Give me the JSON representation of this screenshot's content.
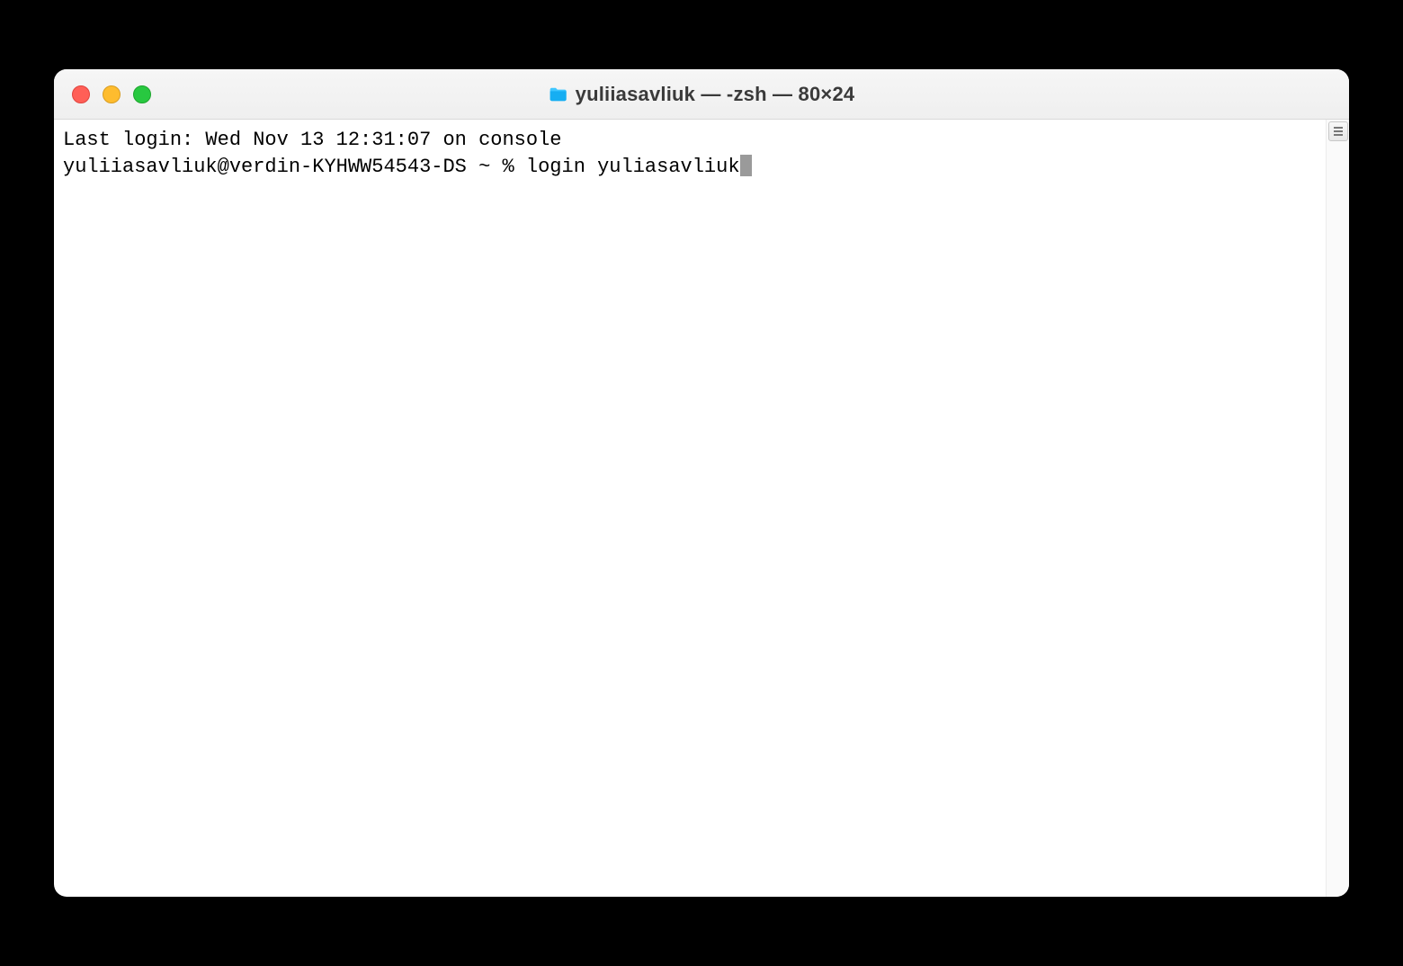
{
  "window": {
    "title": "yuliiasavliuk — -zsh — 80×24"
  },
  "terminal": {
    "last_login_line": "Last login: Wed Nov 13 12:31:07 on console",
    "prompt": "yuliiasavliuk@verdin-KYHWW54543-DS ~ % ",
    "typed_command": "login yuliasavliuk"
  }
}
